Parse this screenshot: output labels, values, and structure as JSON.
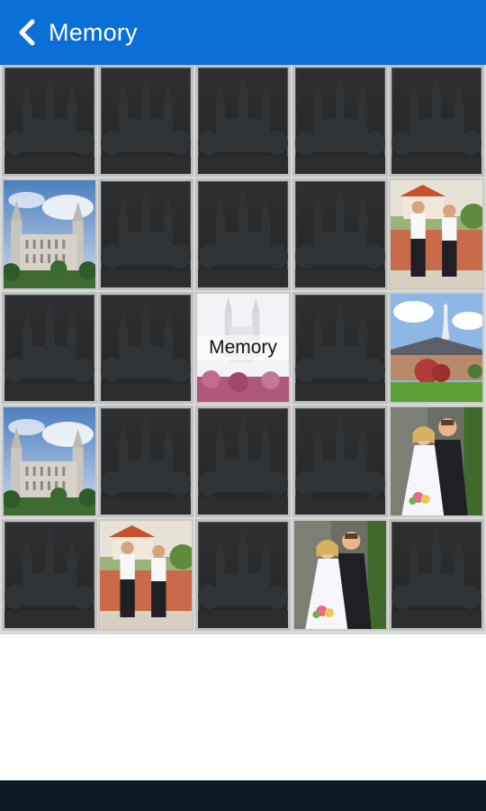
{
  "app": {
    "title": "Memory",
    "back_icon": "chevron-left-icon",
    "colors": {
      "appbar": "#0a6fd6",
      "card_back": "#2a2c2e",
      "nav_bar": "#0c1b24"
    }
  },
  "board": {
    "rows": 5,
    "cols": 5,
    "cards": [
      {
        "face": "back"
      },
      {
        "face": "back"
      },
      {
        "face": "back"
      },
      {
        "face": "back"
      },
      {
        "face": "back"
      },
      {
        "face": "temple"
      },
      {
        "face": "back"
      },
      {
        "face": "back"
      },
      {
        "face": "back"
      },
      {
        "face": "missionaries"
      },
      {
        "face": "back"
      },
      {
        "face": "back"
      },
      {
        "face": "logo",
        "label": "Memory"
      },
      {
        "face": "back"
      },
      {
        "face": "chapel"
      },
      {
        "face": "temple"
      },
      {
        "face": "back"
      },
      {
        "face": "back"
      },
      {
        "face": "back"
      },
      {
        "face": "couple"
      },
      {
        "face": "back"
      },
      {
        "face": "missionaries"
      },
      {
        "face": "back"
      },
      {
        "face": "couple"
      },
      {
        "face": "back"
      }
    ]
  }
}
